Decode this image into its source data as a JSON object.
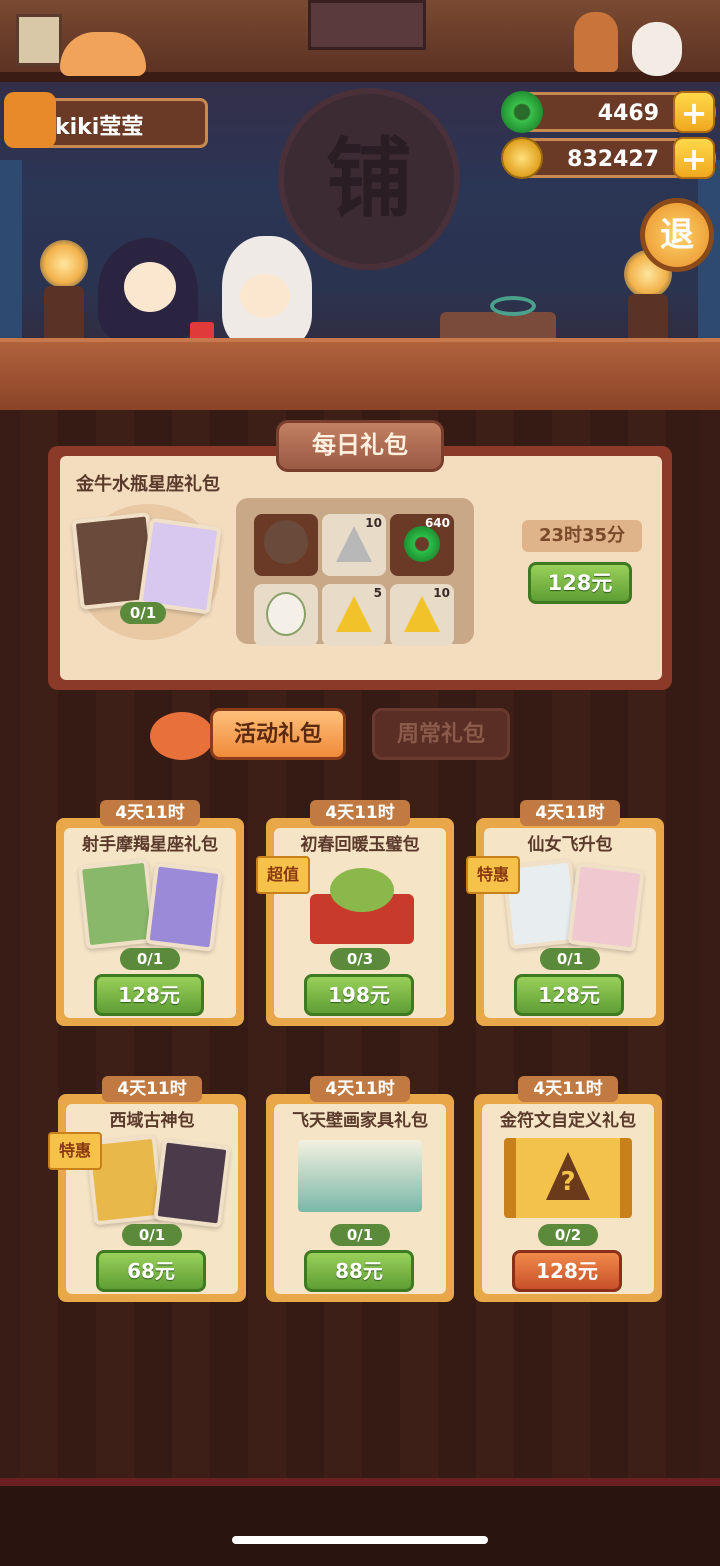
{
  "player": {
    "name": "kiki莹莹"
  },
  "currency": {
    "jade": "4469",
    "coins": "832427"
  },
  "shop": {
    "sign": "铺",
    "exit_label": "退"
  },
  "daily": {
    "tab_label": "每日礼包",
    "pack_name": "金牛水瓶星座礼包",
    "progress": "0/1",
    "timer": "23时35分",
    "price": "128元",
    "items": [
      {
        "icon": "character-card-icon",
        "count": ""
      },
      {
        "icon": "silver-token-icon",
        "count": "10"
      },
      {
        "icon": "jade-ring-icon",
        "count": "640"
      },
      {
        "icon": "character-card-icon",
        "count": ""
      },
      {
        "icon": "gold-token-icon",
        "count": "5"
      },
      {
        "icon": "gold-token-icon",
        "count": "10"
      }
    ]
  },
  "tabs": {
    "active": "活动礼包",
    "inactive": "周常礼包"
  },
  "gifts": [
    {
      "timer": "4天11时",
      "name": "射手摩羯星座礼包",
      "progress": "0/1",
      "price": "128元",
      "tag": ""
    },
    {
      "timer": "4天11时",
      "name": "初春回暖玉璧包",
      "progress": "0/3",
      "price": "198元",
      "tag": "超值"
    },
    {
      "timer": "4天11时",
      "name": "仙女飞升包",
      "progress": "0/1",
      "price": "128元",
      "tag": "特惠"
    },
    {
      "timer": "4天11时",
      "name": "西域古神包",
      "progress": "0/1",
      "price": "68元",
      "tag": "特惠"
    },
    {
      "timer": "4天11时",
      "name": "飞天壁画家具礼包",
      "progress": "0/1",
      "price": "88元",
      "tag": ""
    },
    {
      "timer": "4天11时",
      "name": "金符文自定义礼包",
      "progress": "0/2",
      "price": "128元",
      "tag": ""
    }
  ],
  "colors": {
    "accent_green": "#5e9e34",
    "accent_orange": "#f08a3a",
    "panel": "#f4dcbf"
  }
}
